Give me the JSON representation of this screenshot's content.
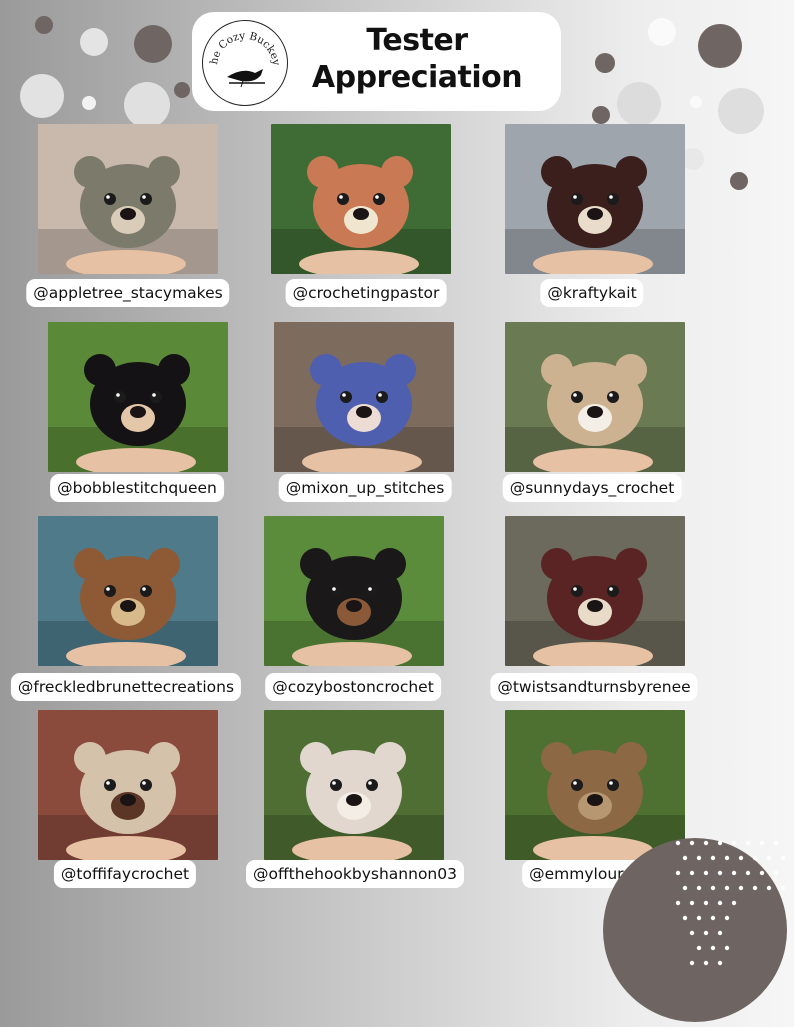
{
  "header": {
    "logo_text": "The Cozy Buckeye",
    "title_line1": "Tester",
    "title_line2": "Appreciation"
  },
  "testers": [
    {
      "handle": "@appletree_stacymakes",
      "bear": "olive-tan bear",
      "bg": "#c9b9ad",
      "body": "#7c7a6a",
      "muzzle": "#d9cdb9"
    },
    {
      "handle": "@crochetingpastor",
      "bear": "orange-brown bear",
      "bg": "#3f6b35",
      "body": "#c97a55",
      "muzzle": "#f0e6d0"
    },
    {
      "handle": "@kraftykait",
      "bear": "white and dark brown bears",
      "bg": "#9ea5ad",
      "body": "#3a1f1c",
      "muzzle": "#e9dccb"
    },
    {
      "handle": "@bobblestitchqueen",
      "bear": "black bear",
      "bg": "#5a8a38",
      "body": "#141214",
      "muzzle": "#e3c7a8"
    },
    {
      "handle": "@mixon_up_stitches",
      "bear": "blue and cream bears",
      "bg": "#7d6b5e",
      "body": "#4f5fb0",
      "muzzle": "#ecdcd4"
    },
    {
      "handle": "@sunnydays_crochet",
      "bear": "tan and white bears",
      "bg": "#6a7a52",
      "body": "#cdb291",
      "muzzle": "#f4efe6"
    },
    {
      "handle": "@freckledbrunettecreations",
      "bear": "brown striped bear",
      "bg": "#4e7a8a",
      "body": "#8e5a35",
      "muzzle": "#d8b98a"
    },
    {
      "handle": "@cozybostoncrochet",
      "bear": "black bear",
      "bg": "#5b8c3c",
      "body": "#1a1819",
      "muzzle": "#8a5a38"
    },
    {
      "handle": "@twistsandturnsbyrenee",
      "bear": "dark brown bear",
      "bg": "#6c6a5c",
      "body": "#5a2424",
      "muzzle": "#e8dcc9"
    },
    {
      "handle": "@toffifaycrochet",
      "bear": "cream bear",
      "bg": "#8a4a3c",
      "body": "#d4c2aa",
      "muzzle": "#5b3526"
    },
    {
      "handle": "@offthehookbyshannon03",
      "bear": "speckled cream bear",
      "bg": "#4f6e33",
      "body": "#e2d7cf",
      "muzzle": "#f3ede6"
    },
    {
      "handle": "@emmylourouch",
      "bear": "light brown bear",
      "bg": "#4e7030",
      "body": "#8c6845",
      "muzzle": "#b79672"
    }
  ],
  "colors": {
    "dot_dark": "#6f6663",
    "dot_light": "#ffffff",
    "accent_circle": "#6e6562"
  }
}
